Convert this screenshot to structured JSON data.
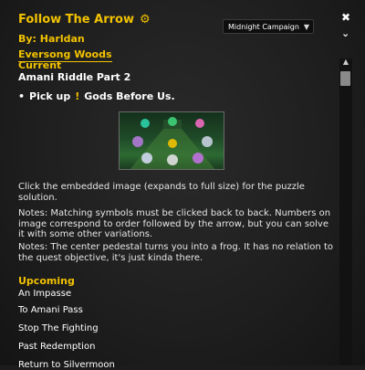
{
  "header": {
    "title": "Follow The Arrow",
    "author": "By: Harldan",
    "zone": "Eversong Woods",
    "current_label": "Current",
    "quest_name": "Amani Riddle Part 2"
  },
  "controls": {
    "campaign_select": "Midnight Campaign",
    "close_glyph": "✖",
    "collapse_glyph": "⌄"
  },
  "objective": {
    "bullet": "•",
    "prefix": "Pick up",
    "marker": "!",
    "item": "Gods Before Us."
  },
  "body": {
    "p1": "Click the embedded image (expands to full size) for the puzzle solution.",
    "p2": "Notes: Matching symbols must be clicked back to back. Numbers on image correspond to order followed by the arrow, but you can solve it with some other variations.",
    "p3": "Notes: The center pedestal turns you into a frog. It has no relation to the quest objective, it's just kinda there."
  },
  "upcoming": {
    "label": "Upcoming",
    "items": [
      "An Impasse",
      "To Amani Pass",
      "Stop The Fighting",
      "Past Redemption",
      "Return to Silvermoon"
    ]
  },
  "icons": {
    "gear": "gear-icon",
    "close": "close-icon",
    "collapse": "chevron-down-icon",
    "exclamation": "exclamation-icon"
  },
  "colors": {
    "accent": "#f2c200",
    "text": "#e6e6e6",
    "background": "#1e1e1e"
  }
}
